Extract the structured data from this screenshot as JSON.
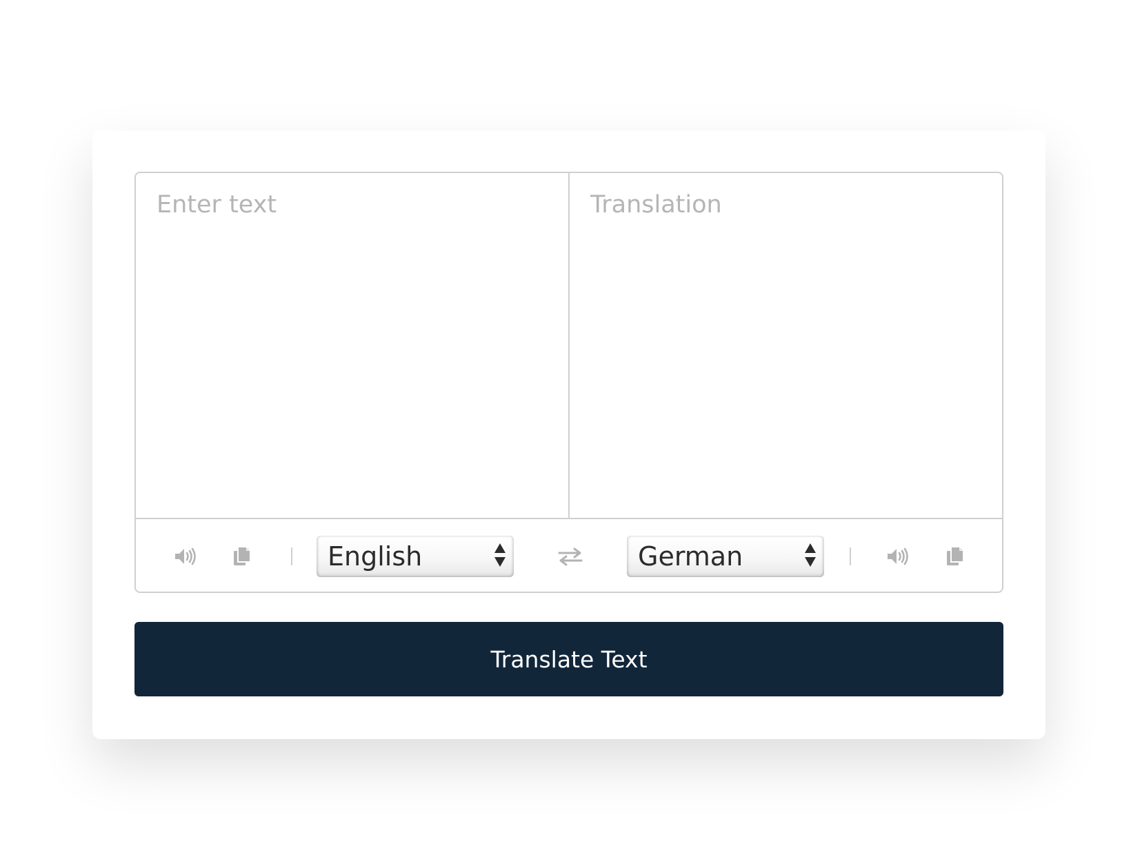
{
  "source": {
    "placeholder": "Enter text",
    "language": "English"
  },
  "target": {
    "placeholder": "Translation",
    "language": "German"
  },
  "icons": {
    "speak": "speaker-icon",
    "copy": "copy-icon",
    "swap": "swap-arrows-icon",
    "select_arrows": "select-arrows-icon"
  },
  "colors": {
    "button_bg": "#12263a",
    "button_text": "#ffffff",
    "icon": "#b3b3b3",
    "border": "#cfcfcf"
  },
  "button": {
    "label": "Translate Text"
  }
}
